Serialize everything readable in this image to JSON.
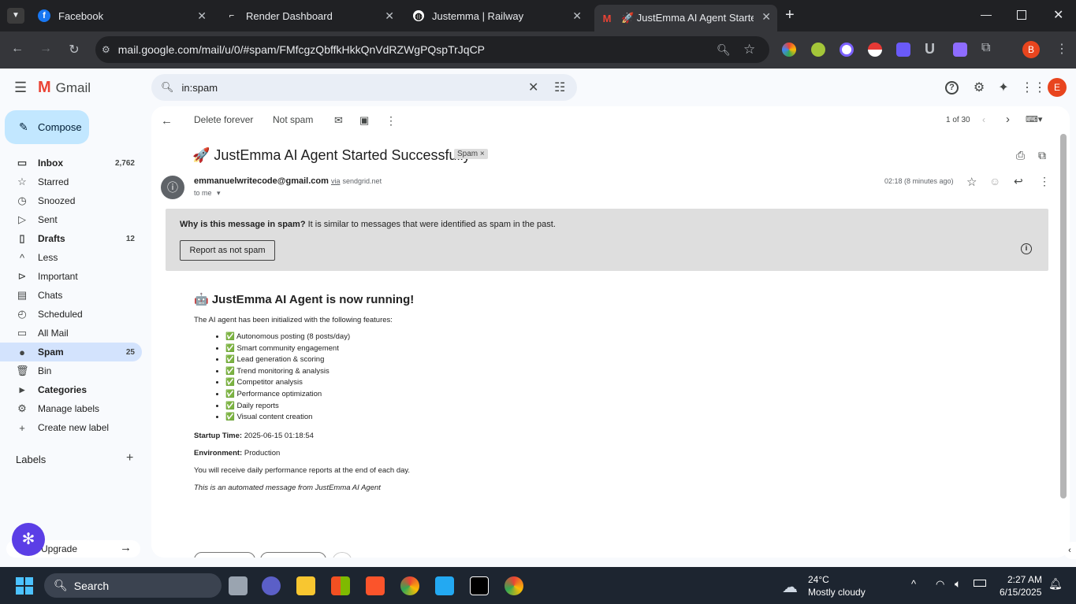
{
  "tabs": [
    {
      "title": "Facebook",
      "favicon": "facebook-icon",
      "color": "#1877f2",
      "glyph": "f"
    },
    {
      "title": "Render Dashboard",
      "favicon": "render-icon",
      "color": "#ffffff",
      "glyph": "⌐"
    },
    {
      "title": "Justemma | Railway",
      "favicon": "railway-icon",
      "color": "#ffffff",
      "glyph": "◍"
    },
    {
      "title": "🚀 JustEmma AI Agent Started",
      "favicon": "gmail-icon",
      "color": "#ea4335",
      "glyph": "M"
    }
  ],
  "url": "mail.google.com/mail/u/0/#spam/FMfcgzQbffkHkkQnVdRZWgPQspTrJqCP",
  "profile_initial": "B",
  "gmail": {
    "logo": "Gmail",
    "search_value": "in:spam",
    "account_initial": "E",
    "compose": "Compose",
    "nav": [
      {
        "label": "Inbox",
        "count": "2,762",
        "bold": true,
        "icon": "inbox-icon",
        "glyph": "▭"
      },
      {
        "label": "Starred",
        "count": "",
        "bold": false,
        "icon": "star-icon",
        "glyph": "☆"
      },
      {
        "label": "Snoozed",
        "count": "",
        "bold": false,
        "icon": "clock-icon",
        "glyph": "◷"
      },
      {
        "label": "Sent",
        "count": "",
        "bold": false,
        "icon": "send-icon",
        "glyph": "▷"
      },
      {
        "label": "Drafts",
        "count": "12",
        "bold": true,
        "icon": "draft-icon",
        "glyph": "▯"
      },
      {
        "label": "Less",
        "count": "",
        "bold": false,
        "icon": "chevron-up-icon",
        "glyph": "^"
      },
      {
        "label": "Important",
        "count": "",
        "bold": false,
        "icon": "important-icon",
        "glyph": "⊳"
      },
      {
        "label": "Chats",
        "count": "",
        "bold": false,
        "icon": "chat-icon",
        "glyph": "▤"
      },
      {
        "label": "Scheduled",
        "count": "",
        "bold": false,
        "icon": "scheduled-icon",
        "glyph": "◴"
      },
      {
        "label": "All Mail",
        "count": "",
        "bold": false,
        "icon": "all-mail-icon",
        "glyph": "▭"
      },
      {
        "label": "Spam",
        "count": "25",
        "bold": true,
        "icon": "spam-icon",
        "glyph": "●",
        "selected": true
      },
      {
        "label": "Bin",
        "count": "",
        "bold": false,
        "icon": "bin-icon",
        "glyph": "🗑"
      },
      {
        "label": "Categories",
        "count": "",
        "bold": true,
        "icon": "categories-icon",
        "glyph": "▸"
      },
      {
        "label": "Manage labels",
        "count": "",
        "bold": false,
        "icon": "settings-icon",
        "glyph": "⚙"
      },
      {
        "label": "Create new label",
        "count": "",
        "bold": false,
        "icon": "plus-icon",
        "glyph": "+"
      }
    ],
    "labels_heading": "Labels",
    "upgrade": "Upgrade",
    "toolbar": {
      "delete_forever": "Delete forever",
      "not_spam": "Not spam",
      "pager": "1 of 30"
    },
    "message": {
      "subject": "🚀 JustEmma AI Agent Started Successfully",
      "spam_chip": "Spam ×",
      "sender": "emmanuelwritecode@gmail.com",
      "via": "via",
      "via_domain": "sendgrid.net",
      "to": "to me",
      "time": "02:18 (8 minutes ago)",
      "banner_bold": "Why is this message in spam?",
      "banner_text": " It is similar to messages that were identified as spam in the past.",
      "report_button": "Report as not spam",
      "heading": "🤖 JustEmma AI Agent is now running!",
      "intro": "The AI agent has been initialized with the following features:",
      "features": [
        "✅ Autonomous posting (8 posts/day)",
        "✅ Smart community engagement",
        "✅ Lead generation & scoring",
        "✅ Trend monitoring & analysis",
        "✅ Competitor analysis",
        "✅ Performance optimization",
        "✅ Daily reports",
        "✅ Visual content creation"
      ],
      "startup_label": "Startup Time:",
      "startup_value": " 2025-06-15 01:18:54",
      "env_label": "Environment:",
      "env_value": " Production",
      "reports_line": "You will receive daily performance reports at the end of each day.",
      "footer": "This is an automated message from JustEmma AI Agent"
    }
  },
  "taskbar": {
    "search": "Search",
    "weather_temp": "24°C",
    "weather_desc": "Mostly cloudy",
    "time": "2:27 AM",
    "date": "6/15/2025"
  }
}
